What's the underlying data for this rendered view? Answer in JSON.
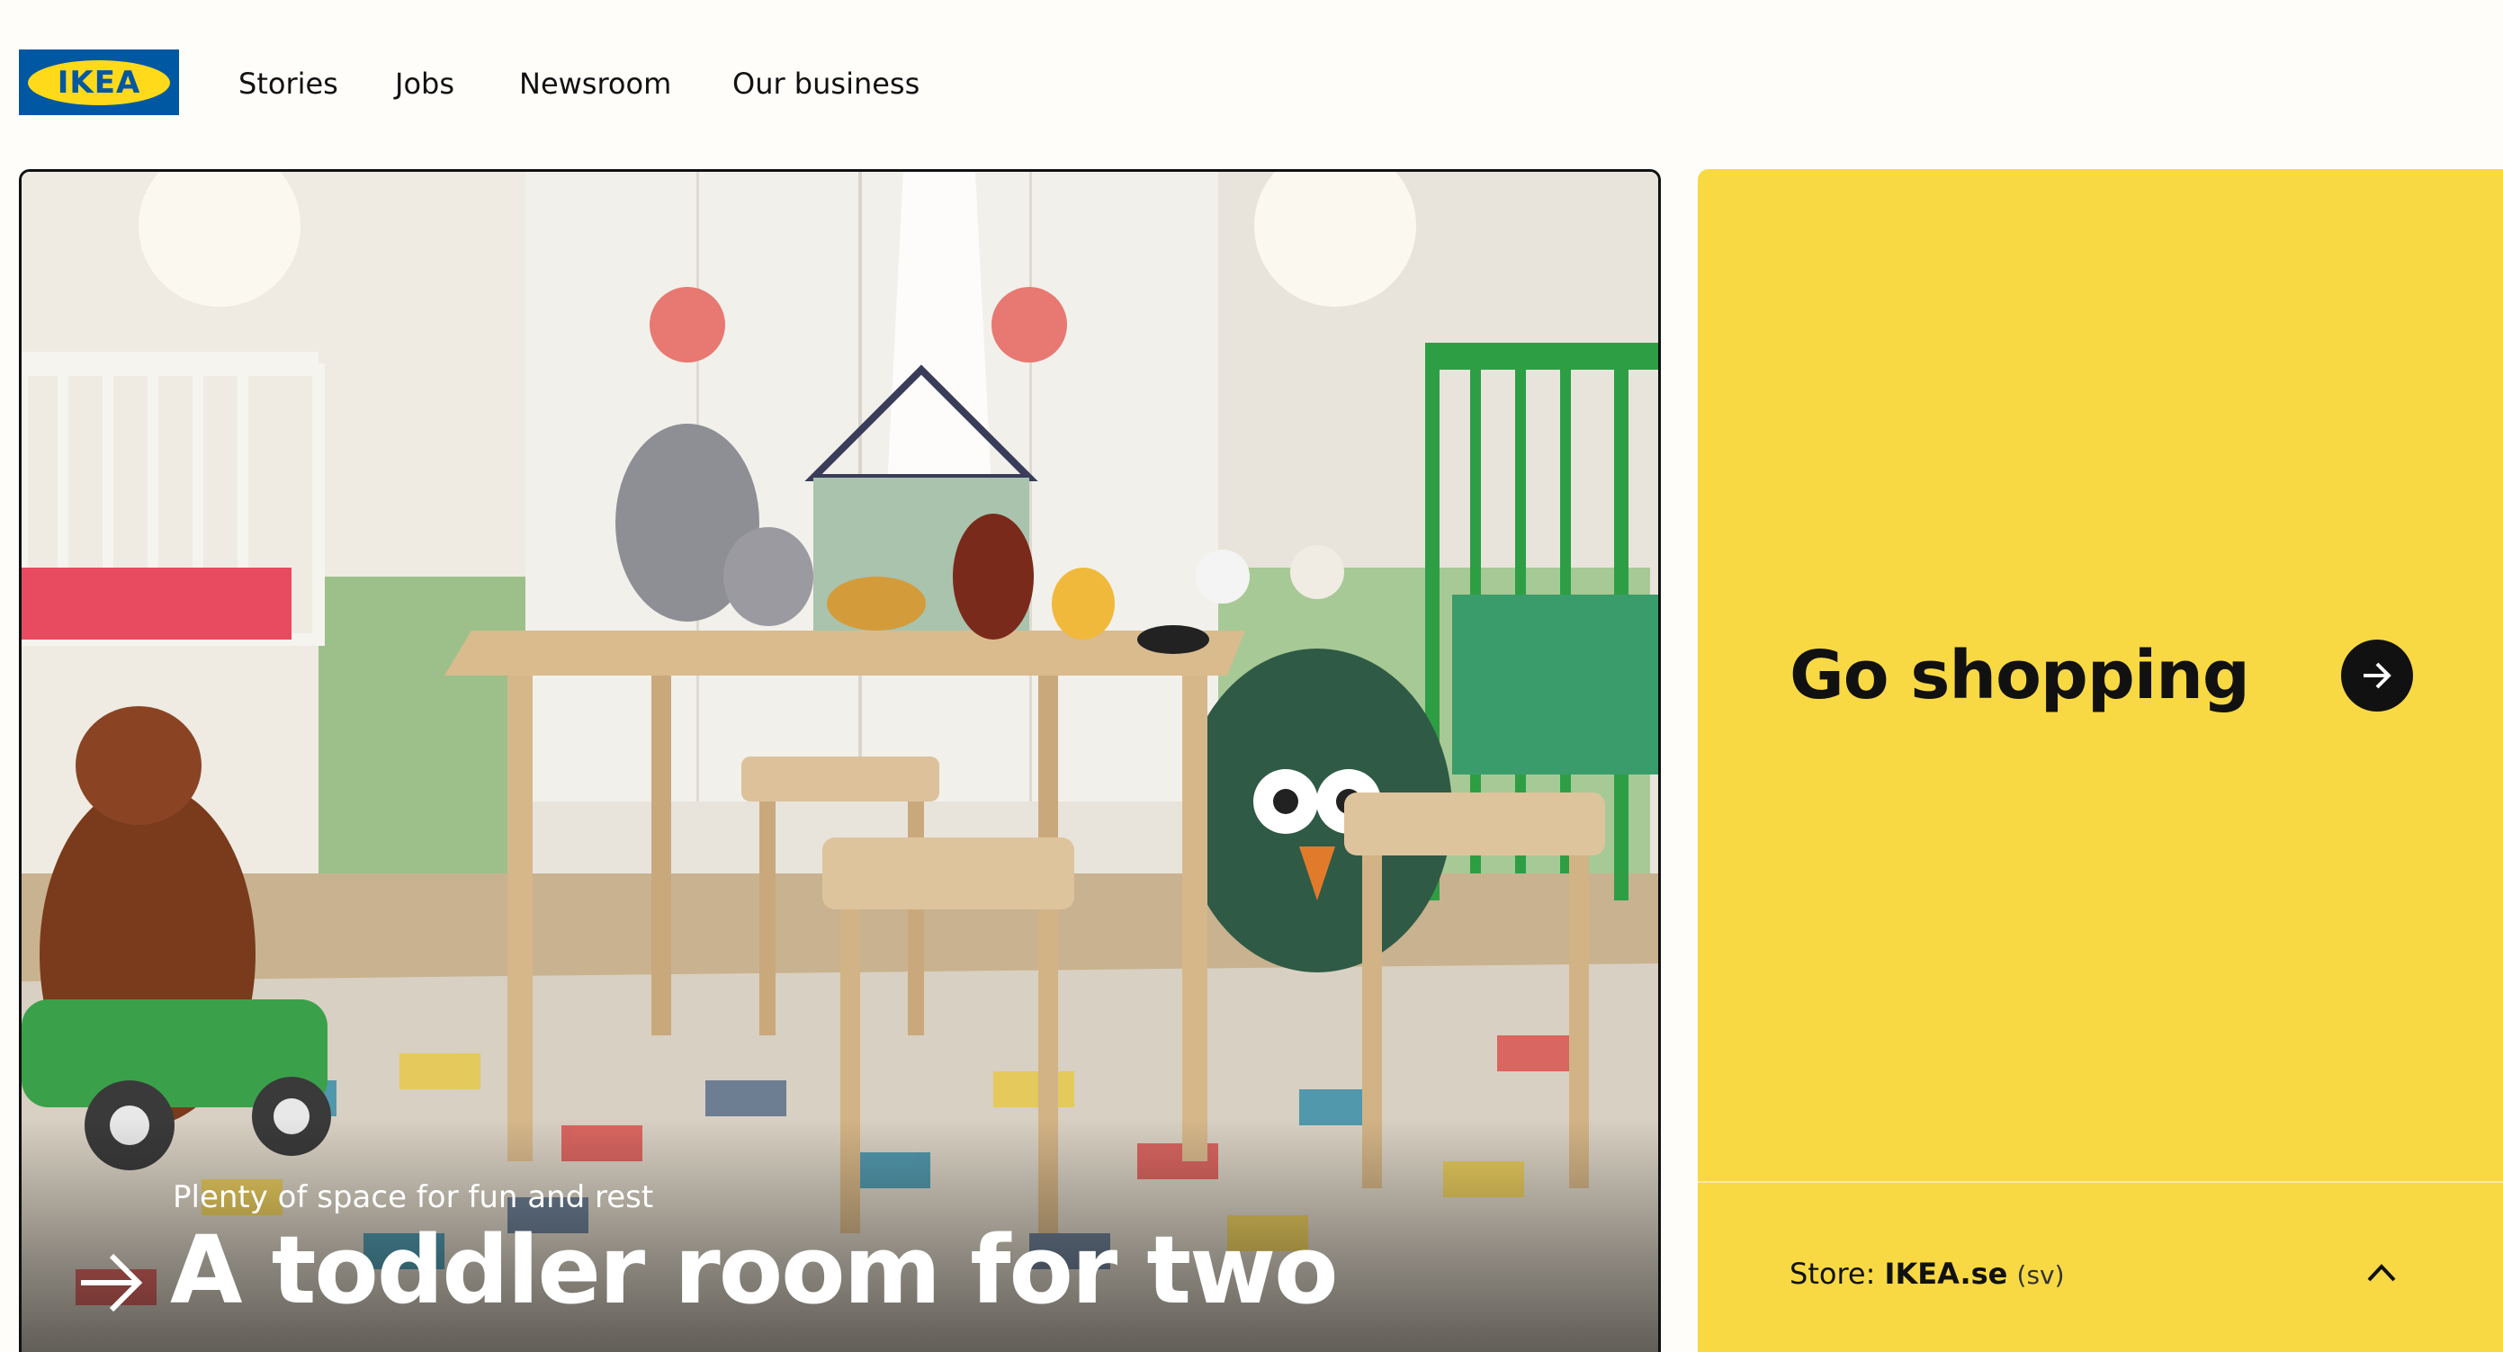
{
  "header": {
    "logo_text": "IKEA",
    "nav": [
      "Stories",
      "Jobs",
      "Newsroom",
      "Our business"
    ]
  },
  "hero": {
    "subtitle": "Plenty of space for fun and rest",
    "title": "A toddler room for two",
    "image": "toddler-room-photo"
  },
  "shop_card": {
    "title": "Go shopping",
    "store_label": "Store:",
    "store_name": "IKEA.se",
    "store_lang": "(sv)"
  },
  "colors": {
    "ikea_blue": "#0058a3",
    "ikea_yellow": "#ffda1a",
    "card_yellow": "#f8d944",
    "background": "#fffdfa",
    "text": "#111111"
  }
}
